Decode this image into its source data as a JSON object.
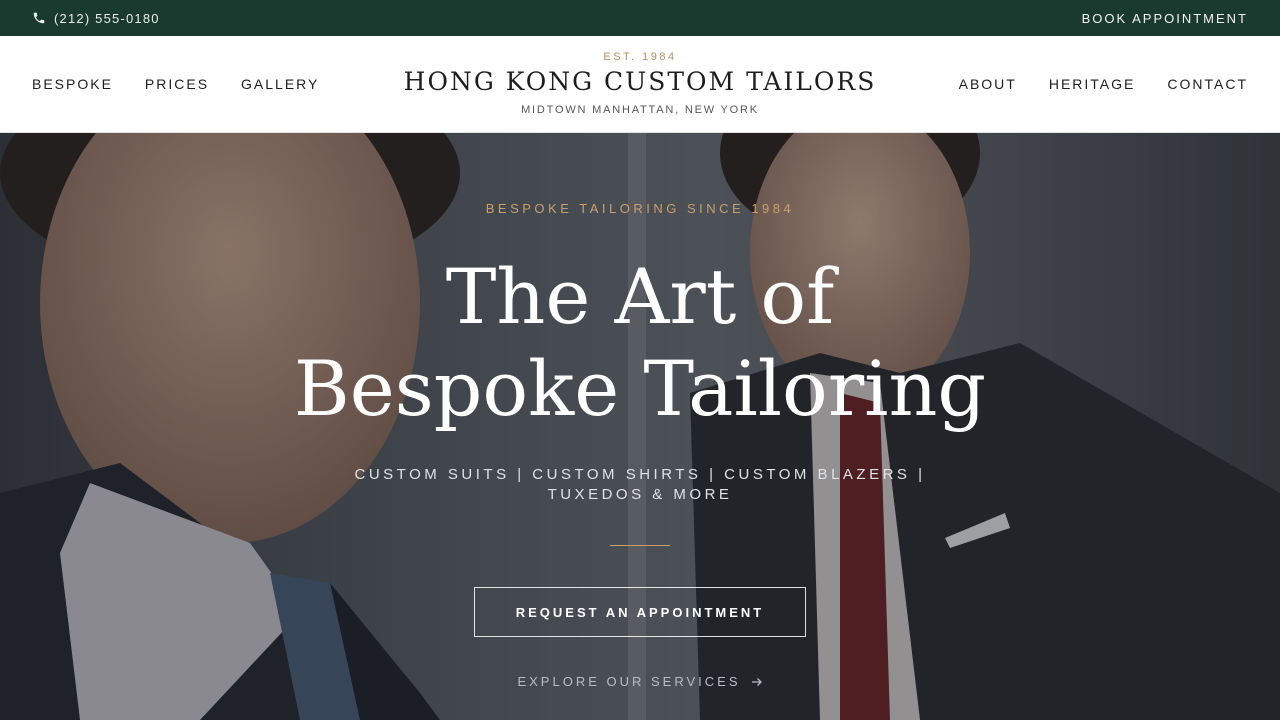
{
  "topbar": {
    "phone_icon": "phone-icon",
    "phone": "(212) 555-0180",
    "book": "BOOK APPOINTMENT"
  },
  "nav": {
    "left": [
      "BESPOKE",
      "PRICES",
      "GALLERY"
    ],
    "right": [
      "ABOUT",
      "HERITAGE",
      "CONTACT"
    ]
  },
  "brand": {
    "est": "EST. 1984",
    "name": "HONG KONG CUSTOM TAILORS",
    "location": "MIDTOWN MANHATTAN, NEW YORK"
  },
  "hero": {
    "eyebrow": "BESPOKE TAILORING SINCE 1984",
    "title_line1": "The Art of",
    "title_line2": "Bespoke Tailoring",
    "services": "CUSTOM SUITS | CUSTOM SHIRTS | CUSTOM BLAZERS | TUXEDOS & MORE",
    "cta": "REQUEST AN APPOINTMENT",
    "explore": "EXPLORE OUR SERVICES",
    "explore_icon": "arrow-right-icon"
  },
  "colors": {
    "topbar_bg": "#1b3a2f",
    "accent_gold": "#c9a06a",
    "text_dark": "#1e1e1e"
  }
}
